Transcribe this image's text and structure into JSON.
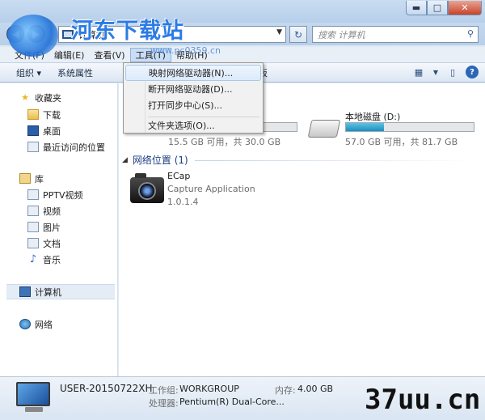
{
  "window": {
    "address_text": "计算机",
    "search_placeholder": "搜索 计算机"
  },
  "menubar": [
    "文件(F)",
    "编辑(E)",
    "查看(V)",
    "工具(T)",
    "帮助(H)"
  ],
  "toolbar": {
    "organize": "组织",
    "system_properties": "系统属性",
    "open_control_panel": "打开控制面板"
  },
  "tools_menu": {
    "items": [
      "映射网络驱动器(N)...",
      "断开网络驱动器(D)...",
      "打开同步中心(S)...",
      "文件夹选项(O)..."
    ]
  },
  "nav": {
    "favorites": "收藏夹",
    "downloads": "下载",
    "desktop": "桌面",
    "recent": "最近访问的位置",
    "libraries": "库",
    "pptv": "PPTV视频",
    "videos": "视频",
    "pictures": "图片",
    "documents": "文档",
    "music": "音乐",
    "computer": "计算机",
    "network": "网络"
  },
  "drives": [
    {
      "name": "",
      "free": "15.5 GB 可用，共 30.0 GB",
      "used_fraction": 0.48
    },
    {
      "name": "本地磁盘 (D:)",
      "free": "57.0 GB 可用，共 81.7 GB",
      "used_fraction": 0.3
    }
  ],
  "network_section": {
    "header": "网络位置 (1)",
    "item_name": "ECap",
    "item_desc": "Capture Application",
    "item_version": "1.0.1.4"
  },
  "details": {
    "computer_name": "USER-20150722XH",
    "workgroup_label": "工作组:",
    "workgroup": "WORKGROUP",
    "memory_label": "内存:",
    "memory": "4.00 GB",
    "processor_label": "处理器:",
    "processor": "Pentium(R) Dual-Core..."
  },
  "watermarks": {
    "site_cn": "河东下载站",
    "site_url": "www.pc0359.cn",
    "corner": "37uu.cn"
  }
}
